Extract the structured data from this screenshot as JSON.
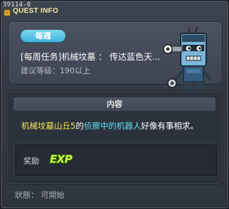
{
  "window": {
    "id_text": "39114-0",
    "title": "QUEST INFO"
  },
  "quest": {
    "badge": "每週",
    "name": "[每周任务]机械坟墓 ： 传达蓝色天...",
    "level": "建议等级：190以上"
  },
  "content": {
    "header": "内容",
    "segments": [
      {
        "text": "机械坟墓山丘5",
        "color": "yellow"
      },
      {
        "text": "的",
        "color": "white"
      },
      {
        "text": "侦察中的机器人",
        "color": "cyan"
      },
      {
        "text": "好像有事相求。",
        "color": "white"
      }
    ]
  },
  "reward": {
    "label": "奖励",
    "icon_text": "EXP"
  },
  "status": {
    "text": "狀態：  可開始"
  },
  "colors": {
    "badge": "#5cc8ea",
    "title": "#f3e6a4",
    "highlight_yellow": "#f5ea5a",
    "highlight_cyan": "#5fe1f0",
    "exp": "#c8f53a"
  },
  "icons": {
    "title_icon": "quest-scroll-icon",
    "portrait": "robot-npc-portrait",
    "reward_icon": "exp-icon"
  }
}
